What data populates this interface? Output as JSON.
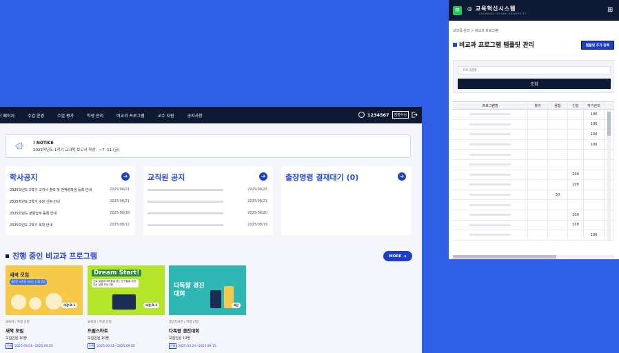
{
  "desktop": {
    "nav": {
      "items": [
        "이 페이지",
        "수업 운영",
        "수업 평가",
        "학생 관리",
        "비교과 프로그램",
        "교수 지원",
        "공지사항"
      ],
      "user_id": "1234567",
      "user_name": "김철수님"
    },
    "notice": {
      "label": "! NOTICE",
      "text": "2025학년도 1학기 교과목 보고서 작성 : ~7. 11.(금)"
    },
    "academic": {
      "title": "학사공지",
      "rows": [
        {
          "title": "2025학년도 2학기 고지서 출력 및 전액장학생 등록 안내",
          "date": "2025/08/21"
        },
        {
          "title": "2025학년도 2학기 수강 신청 안내",
          "date": "2025/08/21"
        },
        {
          "title": "2025학년도 분할납부 등록 안내",
          "date": "2025/08/18"
        },
        {
          "title": "2025학년도 2학기 복학 안내",
          "date": "2025/08/12"
        }
      ]
    },
    "staff": {
      "title": "교직원 공지",
      "dates": [
        "2025/08/25",
        "2025/08/21",
        "2025/08/20",
        "2025/08/19"
      ]
    },
    "approval": {
      "title": "출장명령 결재대기 (0)"
    },
    "programs": {
      "title": "진행 중인 비교과 프로그램",
      "more": "MORE",
      "cards": [
        {
          "img_title": "새싹 모임",
          "img_sub": "새로운 시작과 자라는 나를 응원",
          "dday": "마감 D-1",
          "category": "교육처 / 학생 신청",
          "name": "새싹 모임",
          "count": "모집인원 10명",
          "tag": "진행",
          "period": "2025.09.01~2025.09.05",
          "color": "#f7c948"
        },
        {
          "img_title": "Dream Start!",
          "img_sub": "진로 설정에 어려움을 겪는 친구들을 위한 진로 설정 프로그램",
          "dday": "마감 D-1",
          "category": "교육처 / 학생 신청",
          "name": "드림스타트",
          "count": "모집인원 10명",
          "tag": "진행",
          "period": "2025.09.01~2025.09.05",
          "color": "#b4e52a"
        },
        {
          "img_title": "다독왕 경진대회",
          "img_sub": "",
          "dday": "마감",
          "category": "중앙도서관 / 학생 신청",
          "name": "다독왕 경진대회",
          "count": "모집인원 10명",
          "tag": "진행",
          "period": "2025.03.24~2025.09.15",
          "color": "#2fb7b3"
        }
      ]
    }
  },
  "mobile": {
    "logo": "교육혁신시스템",
    "logo_sub": "CHUNNAM TECHNO UNIVERSITY",
    "breadcrumb": "교과목 관리 > 비교과 프로그램",
    "title": "비교과 프로그램 템플릿 관리",
    "add_button": "템플릿 추가 등록",
    "input_placeholder": "프로그램명",
    "search_button": "조회",
    "table": {
      "headers": [
        "프로그램명",
        "창의",
        "융합",
        "인성",
        "자기관리",
        ""
      ],
      "rows": [
        [
          "",
          "",
          "",
          "",
          "100"
        ],
        [
          "",
          "",
          "",
          "",
          "100"
        ],
        [
          "",
          "",
          "",
          "",
          "100"
        ],
        [
          "",
          "",
          "",
          "",
          "100"
        ],
        [
          "",
          "",
          "",
          "",
          ""
        ],
        [
          "",
          "",
          "",
          "",
          ""
        ],
        [
          "",
          "",
          "",
          "100",
          ""
        ],
        [
          "",
          "",
          "",
          "100",
          ""
        ],
        [
          "",
          "",
          "50",
          "",
          ""
        ],
        [
          "",
          "",
          "",
          "",
          ""
        ],
        [
          "",
          "",
          "",
          "100",
          ""
        ],
        [
          "",
          "",
          "",
          "100",
          ""
        ],
        [
          "",
          "",
          "",
          "",
          "100"
        ]
      ]
    }
  }
}
